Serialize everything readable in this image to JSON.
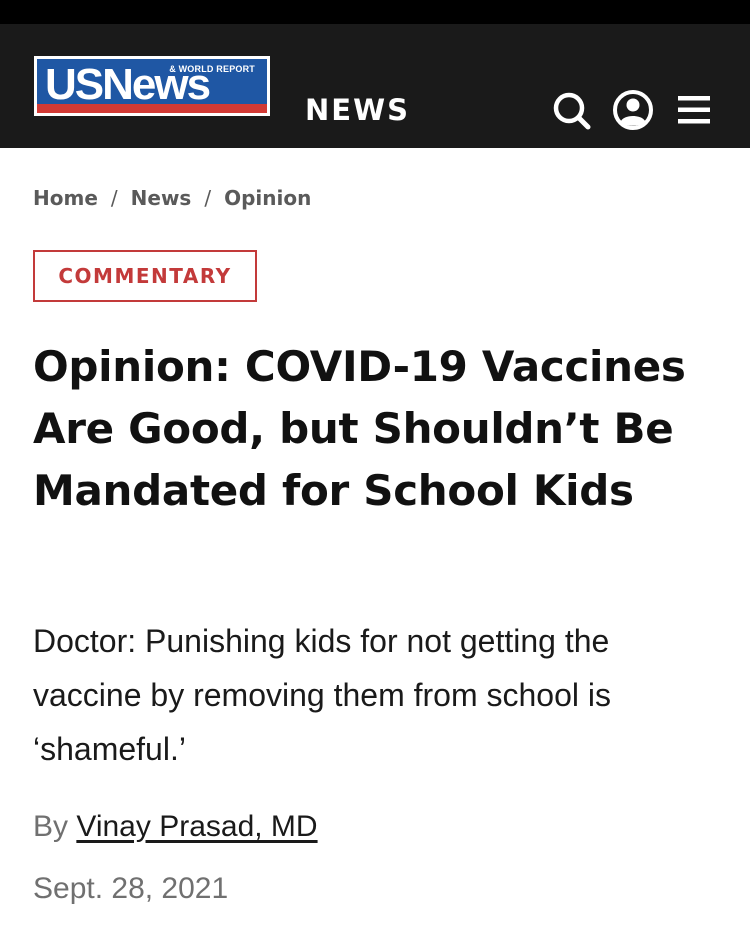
{
  "header": {
    "logo": {
      "main_text": "USNews",
      "sub_text": "& WORLD REPORT",
      "colors": {
        "blue": "#1f57a4",
        "red": "#d23a35",
        "white": "#ffffff"
      }
    },
    "section_title": "NEWS",
    "icons": [
      "search-icon",
      "account-icon",
      "menu-icon"
    ]
  },
  "breadcrumb": {
    "items": [
      "Home",
      "News",
      "Opinion"
    ],
    "separator": "/"
  },
  "article": {
    "badge": "COMMENTARY",
    "headline": "Opinion: COVID-19 Vaccines Are Good, but Shouldn’t Be Mandated for School Kids",
    "dek": "Doctor: Punishing kids for not getting the vaccine by removing them from school is ‘shameful.’",
    "byline_prefix": "By",
    "author": "Vinay Prasad, MD",
    "date": "Sept. 28, 2021"
  },
  "colors": {
    "header_bg": "#1a1a1a",
    "top_bar": "#000000",
    "accent_red": "#c33a3a",
    "breadcrumb_gray": "#5a5a5a",
    "meta_gray": "#707070"
  }
}
